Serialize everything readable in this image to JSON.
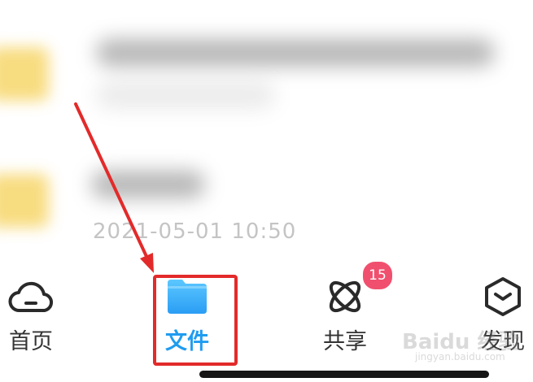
{
  "list": {
    "rows": [
      {
        "date": ""
      },
      {
        "date": "2021-05-01  10:50"
      }
    ]
  },
  "tabbar": {
    "tabs": [
      {
        "label": "首页",
        "icon": "cloud-icon"
      },
      {
        "label": "文件",
        "icon": "folder-icon",
        "active": true
      },
      {
        "label": "共享",
        "icon": "atom-icon",
        "badge": "15"
      },
      {
        "label": "发现",
        "icon": "hexagon-icon"
      }
    ],
    "active_color": "#1f9cf0",
    "badge_color": "#f0506e"
  },
  "annotation": {
    "color": "#e32a2a"
  },
  "watermark": {
    "text": "Baidu 经验",
    "sub": "jingyan.baidu.com"
  }
}
